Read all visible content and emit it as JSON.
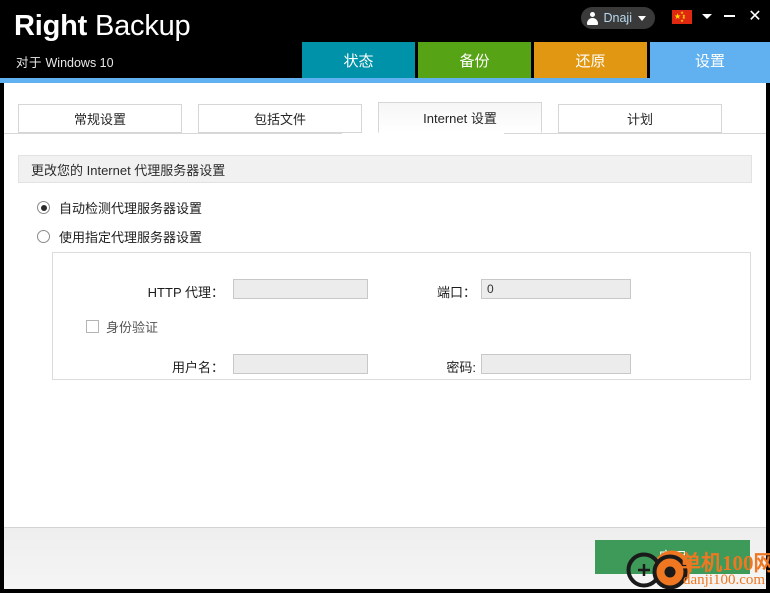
{
  "window": {
    "brand_bold": "Right",
    "brand_light": " Backup",
    "subtitle_cn": "对于",
    "subtitle_os": " Windows 10",
    "user_name": "Dnaji",
    "user_icon": "person-icon",
    "user_caret_icon": "chevron-down-icon",
    "flag_icon": "china-flag-icon",
    "flag_caret_icon": "chevron-down-icon",
    "minimize_label": "–",
    "close_label": "✕",
    "accent_color": "#61b0ef",
    "titlebar_color": "#000000"
  },
  "main_tabs": [
    {
      "label": "状态",
      "color": "#0092a8",
      "active": false
    },
    {
      "label": "备份",
      "color": "#57a316",
      "active": false
    },
    {
      "label": "还原",
      "color": "#e29712",
      "active": false
    },
    {
      "label": "设置",
      "color": "#61b0ef",
      "active": true
    }
  ],
  "sub_tabs": [
    {
      "label": "常规设置",
      "active": false
    },
    {
      "label": "包括文件",
      "active": false
    },
    {
      "label": "Internet 设置",
      "active": true
    },
    {
      "label": "计划",
      "active": false
    }
  ],
  "section": {
    "header": "更改您的 Internet 代理服务器设置"
  },
  "radios": [
    {
      "label": "自动检测代理服务器设置",
      "checked": true
    },
    {
      "label": "使用指定代理服务器设置",
      "checked": false
    }
  ],
  "proxy_form": {
    "http_label": "HTTP 代理：",
    "http_value": "",
    "http_placeholder": "",
    "port_label": "端口：",
    "port_value": "0",
    "auth_checkbox_label": "身份验证",
    "auth_checked": false,
    "username_label": "用户名：",
    "username_value": "",
    "password_label": "密码:",
    "password_value": ""
  },
  "footer": {
    "apply_label": "应用",
    "apply_color": "#3e9a58"
  },
  "watermark": {
    "line1": "单机100网",
    "line2": "danji100.com",
    "color": "#ef7722"
  }
}
